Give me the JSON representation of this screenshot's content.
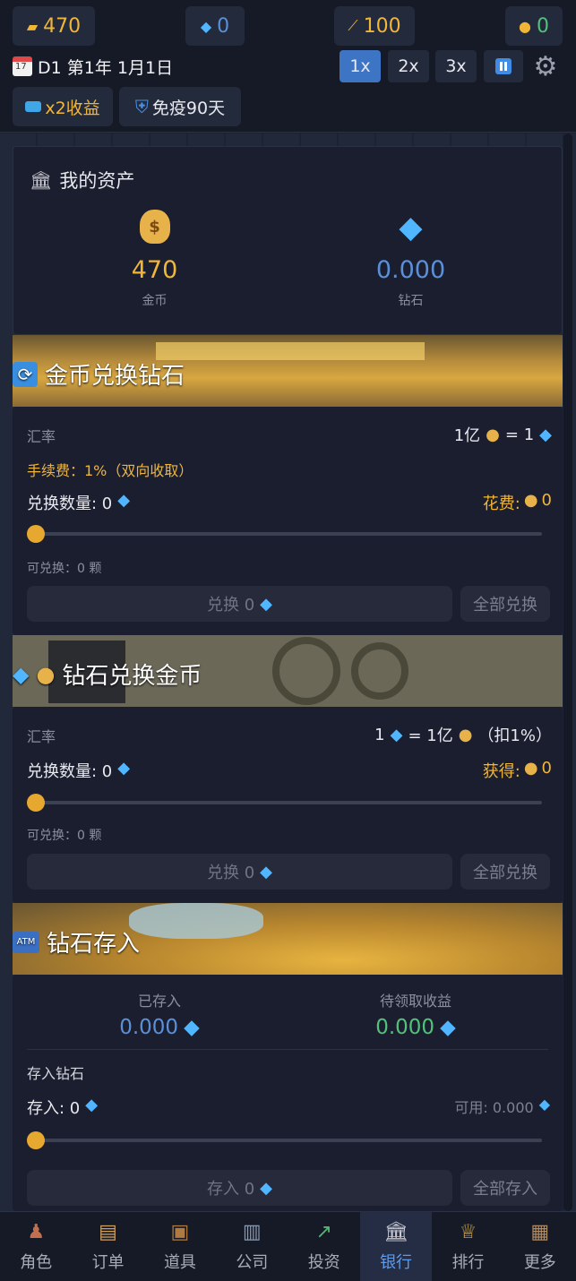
{
  "resources": {
    "gold": "470",
    "diamond": "0",
    "energy": "100",
    "coin": "0"
  },
  "date": {
    "text": "D1 第1年 1月1日"
  },
  "speed": {
    "s1": "1x",
    "s2": "2x",
    "s3": "3x"
  },
  "chips": {
    "income": "x2收益",
    "immune": "免疫90天"
  },
  "assets": {
    "title": "我的资产",
    "gold_value": "470",
    "gold_label": "金币",
    "diamond_value": "0.000",
    "diamond_label": "钻石"
  },
  "gold_to_diamond": {
    "title": "金币兑换钻石",
    "rate_label": "汇率",
    "rate_left": "1亿",
    "rate_right": "= 1",
    "fee": "手续费：1%（双向收取）",
    "qty_label": "兑换数量: 0",
    "cost_label": "花费:",
    "cost_value": "0",
    "available": "可兑换：0 颗",
    "exchange_btn": "兑换 0",
    "all_btn": "全部兑换"
  },
  "diamond_to_gold": {
    "title": "钻石兑换金币",
    "rate_label": "汇率",
    "rate_left": "1",
    "rate_mid": "= 1亿",
    "rate_tail": "（扣1%）",
    "qty_label": "兑换数量: 0",
    "gain_label": "获得:",
    "gain_value": "0",
    "available": "可兑换：0 颗",
    "exchange_btn": "兑换 0",
    "all_btn": "全部兑换"
  },
  "deposit": {
    "title": "钻石存入",
    "saved_label": "已存入",
    "saved_value": "0.000",
    "pending_label": "待领取收益",
    "pending_value": "0.000",
    "section_label": "存入钻石",
    "deposit_label": "存入: 0",
    "available_label": "可用: 0.000",
    "deposit_btn": "存入 0",
    "all_btn": "全部存入"
  },
  "nav": [
    {
      "label": "角色",
      "icon": "person-icon"
    },
    {
      "label": "订单",
      "icon": "clipboard-icon"
    },
    {
      "label": "道具",
      "icon": "chest-icon"
    },
    {
      "label": "公司",
      "icon": "building-icon"
    },
    {
      "label": "投资",
      "icon": "chart-icon"
    },
    {
      "label": "银行",
      "icon": "bank-icon"
    },
    {
      "label": "排行",
      "icon": "trophy-icon"
    },
    {
      "label": "更多",
      "icon": "box-icon"
    }
  ],
  "colors": {
    "accent": "#3d74c4",
    "gold": "#f2b637",
    "diamond": "#5b8fd8",
    "green": "#52c27a"
  }
}
